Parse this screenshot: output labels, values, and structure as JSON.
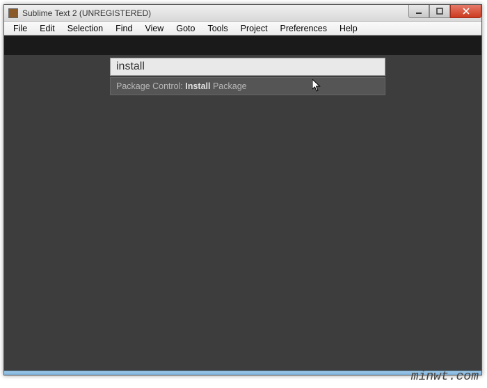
{
  "titlebar": {
    "text": "Sublime Text 2 (UNREGISTERED)"
  },
  "menubar": {
    "items": [
      "File",
      "Edit",
      "Selection",
      "Find",
      "View",
      "Goto",
      "Tools",
      "Project",
      "Preferences",
      "Help"
    ]
  },
  "palette": {
    "input_value": "install",
    "result_prefix": "Package Control: ",
    "result_bold": "Install",
    "result_suffix": " Package"
  },
  "watermark": "minwt.com"
}
